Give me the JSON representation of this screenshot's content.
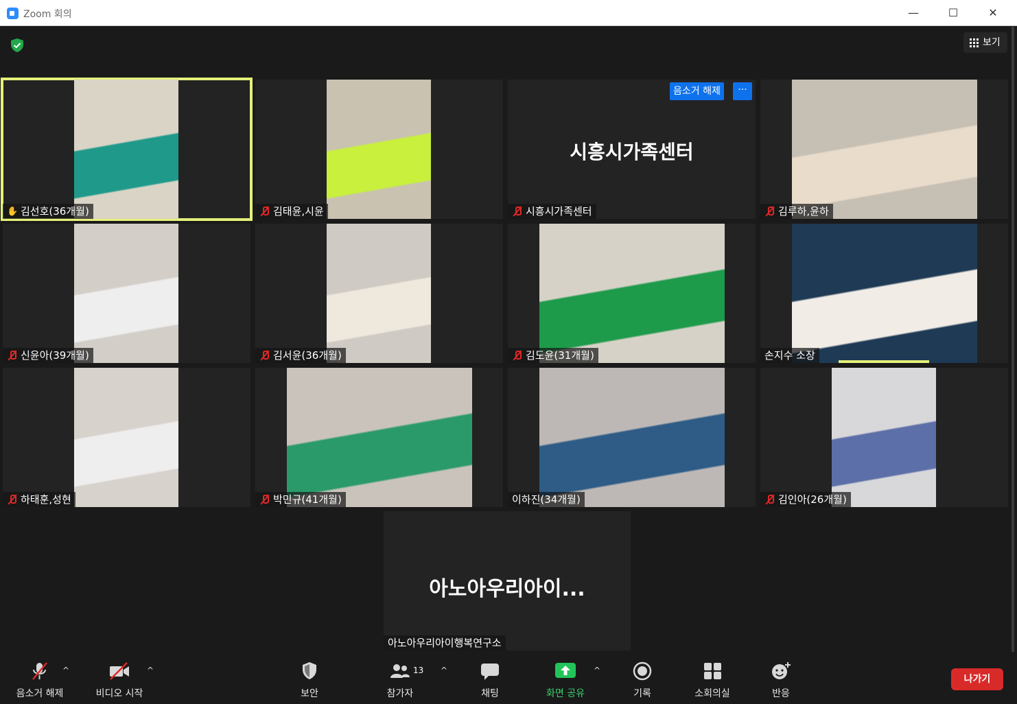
{
  "window": {
    "title": "Zoom 회의",
    "minimize": "—",
    "maximize": "☐",
    "close": "✕"
  },
  "header": {
    "view_label": "보기"
  },
  "tiles": [
    {
      "name": "김선호(36개월)",
      "mic": "hand",
      "active": true,
      "video_bg": "#d9d4c6",
      "video_fg": "#1f9a8a"
    },
    {
      "name": "김태윤,시윤",
      "mic": "muted",
      "video_bg": "#c9c2b0",
      "video_fg": "#c8f03c"
    },
    {
      "name": "시흥시가족센터",
      "mic": "muted",
      "big_name": "시흥시가족센터",
      "unmute": "음소거 해제",
      "more": "···"
    },
    {
      "name": "김루하,윤하",
      "mic": "muted",
      "video_bg": "#c6bfb4",
      "video_fg": "#e9dccb"
    },
    {
      "name": "신윤아(39개월)",
      "mic": "muted",
      "video_bg": "#d3cfc8",
      "video_fg": "#eeeeee"
    },
    {
      "name": "김서윤(36개월)",
      "mic": "muted",
      "video_bg": "#cfcac3",
      "video_fg": "#efe8dd"
    },
    {
      "name": "김도윤(31개월)",
      "mic": "muted",
      "video_bg": "#d7d2c8",
      "video_fg": "#1e9a4b"
    },
    {
      "name": "손지수 소장",
      "mic": "none",
      "video_bg": "#1e3a55",
      "video_fg": "#f1ece6"
    },
    {
      "name": "하태훈,성현",
      "mic": "muted",
      "video_bg": "#d8d2cc",
      "video_fg": "#eeeeee"
    },
    {
      "name": "박민규(41개월)",
      "mic": "muted",
      "video_bg": "#c9c3bb",
      "video_fg": "#2b9a6a"
    },
    {
      "name": "이하진(34개월)",
      "mic": "none",
      "video_bg": "#bdb8b6",
      "video_fg": "#2e5c86"
    },
    {
      "name": "김인아(26개월)",
      "mic": "muted",
      "video_bg": "#d8d8da",
      "video_fg": "#5c6fa8"
    }
  ],
  "bottom_tile": {
    "big_name": "아노아우리아이...",
    "name": "아노아우리아이행복연구소"
  },
  "toolbar": {
    "unmute": "음소거 해제",
    "start_video": "비디오 시작",
    "security": "보안",
    "participants": "참가자",
    "participants_count": "13",
    "chat": "채팅",
    "share_screen": "화면 공유",
    "record": "기록",
    "breakout": "소회의실",
    "reactions": "반응",
    "leave": "나가기",
    "caret": "^"
  },
  "colors": {
    "accent": "#0e72ed",
    "active_border": "#e4f07a",
    "muted_red": "#e02828",
    "share_green": "#3cd070",
    "leave_red": "#d92a2a"
  }
}
